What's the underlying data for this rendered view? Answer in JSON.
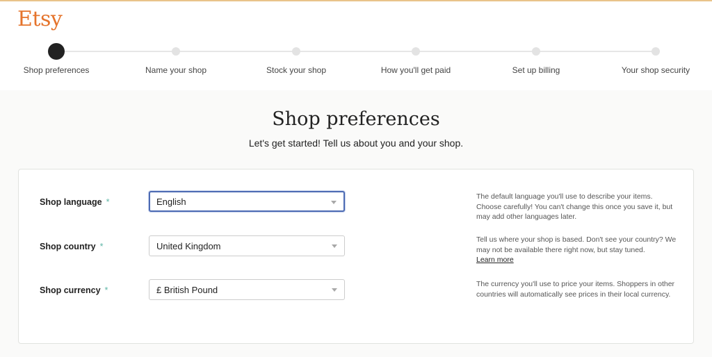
{
  "brand": {
    "logo_text": "Etsy",
    "color": "#e5742c"
  },
  "steps": [
    {
      "label": "Shop preferences",
      "active": true
    },
    {
      "label": "Name your shop",
      "active": false
    },
    {
      "label": "Stock your shop",
      "active": false
    },
    {
      "label": "How you'll get paid",
      "active": false
    },
    {
      "label": "Set up billing",
      "active": false
    },
    {
      "label": "Your shop security",
      "active": false
    }
  ],
  "page": {
    "title": "Shop preferences",
    "subtitle": "Let's get started! Tell us about you and your shop."
  },
  "form": {
    "required_marker": "*",
    "required_color": "#5fb6a7",
    "focus_color": "#4d6bb3",
    "fields": [
      {
        "label": "Shop language",
        "value": "English",
        "focused": true,
        "help": "The default language you'll use to describe your items. Choose carefully! You can't change this once you save it, but may add other languages later."
      },
      {
        "label": "Shop country",
        "value": "United Kingdom",
        "focused": false,
        "help": "Tell us where your shop is based. Don't see your country? We may not be available there right now, but stay tuned.",
        "help_link": "Learn more"
      },
      {
        "label": "Shop currency",
        "value": "£ British Pound",
        "focused": false,
        "help": "The currency you'll use to price your items. Shoppers in other countries will automatically see prices in their local currency."
      }
    ]
  }
}
